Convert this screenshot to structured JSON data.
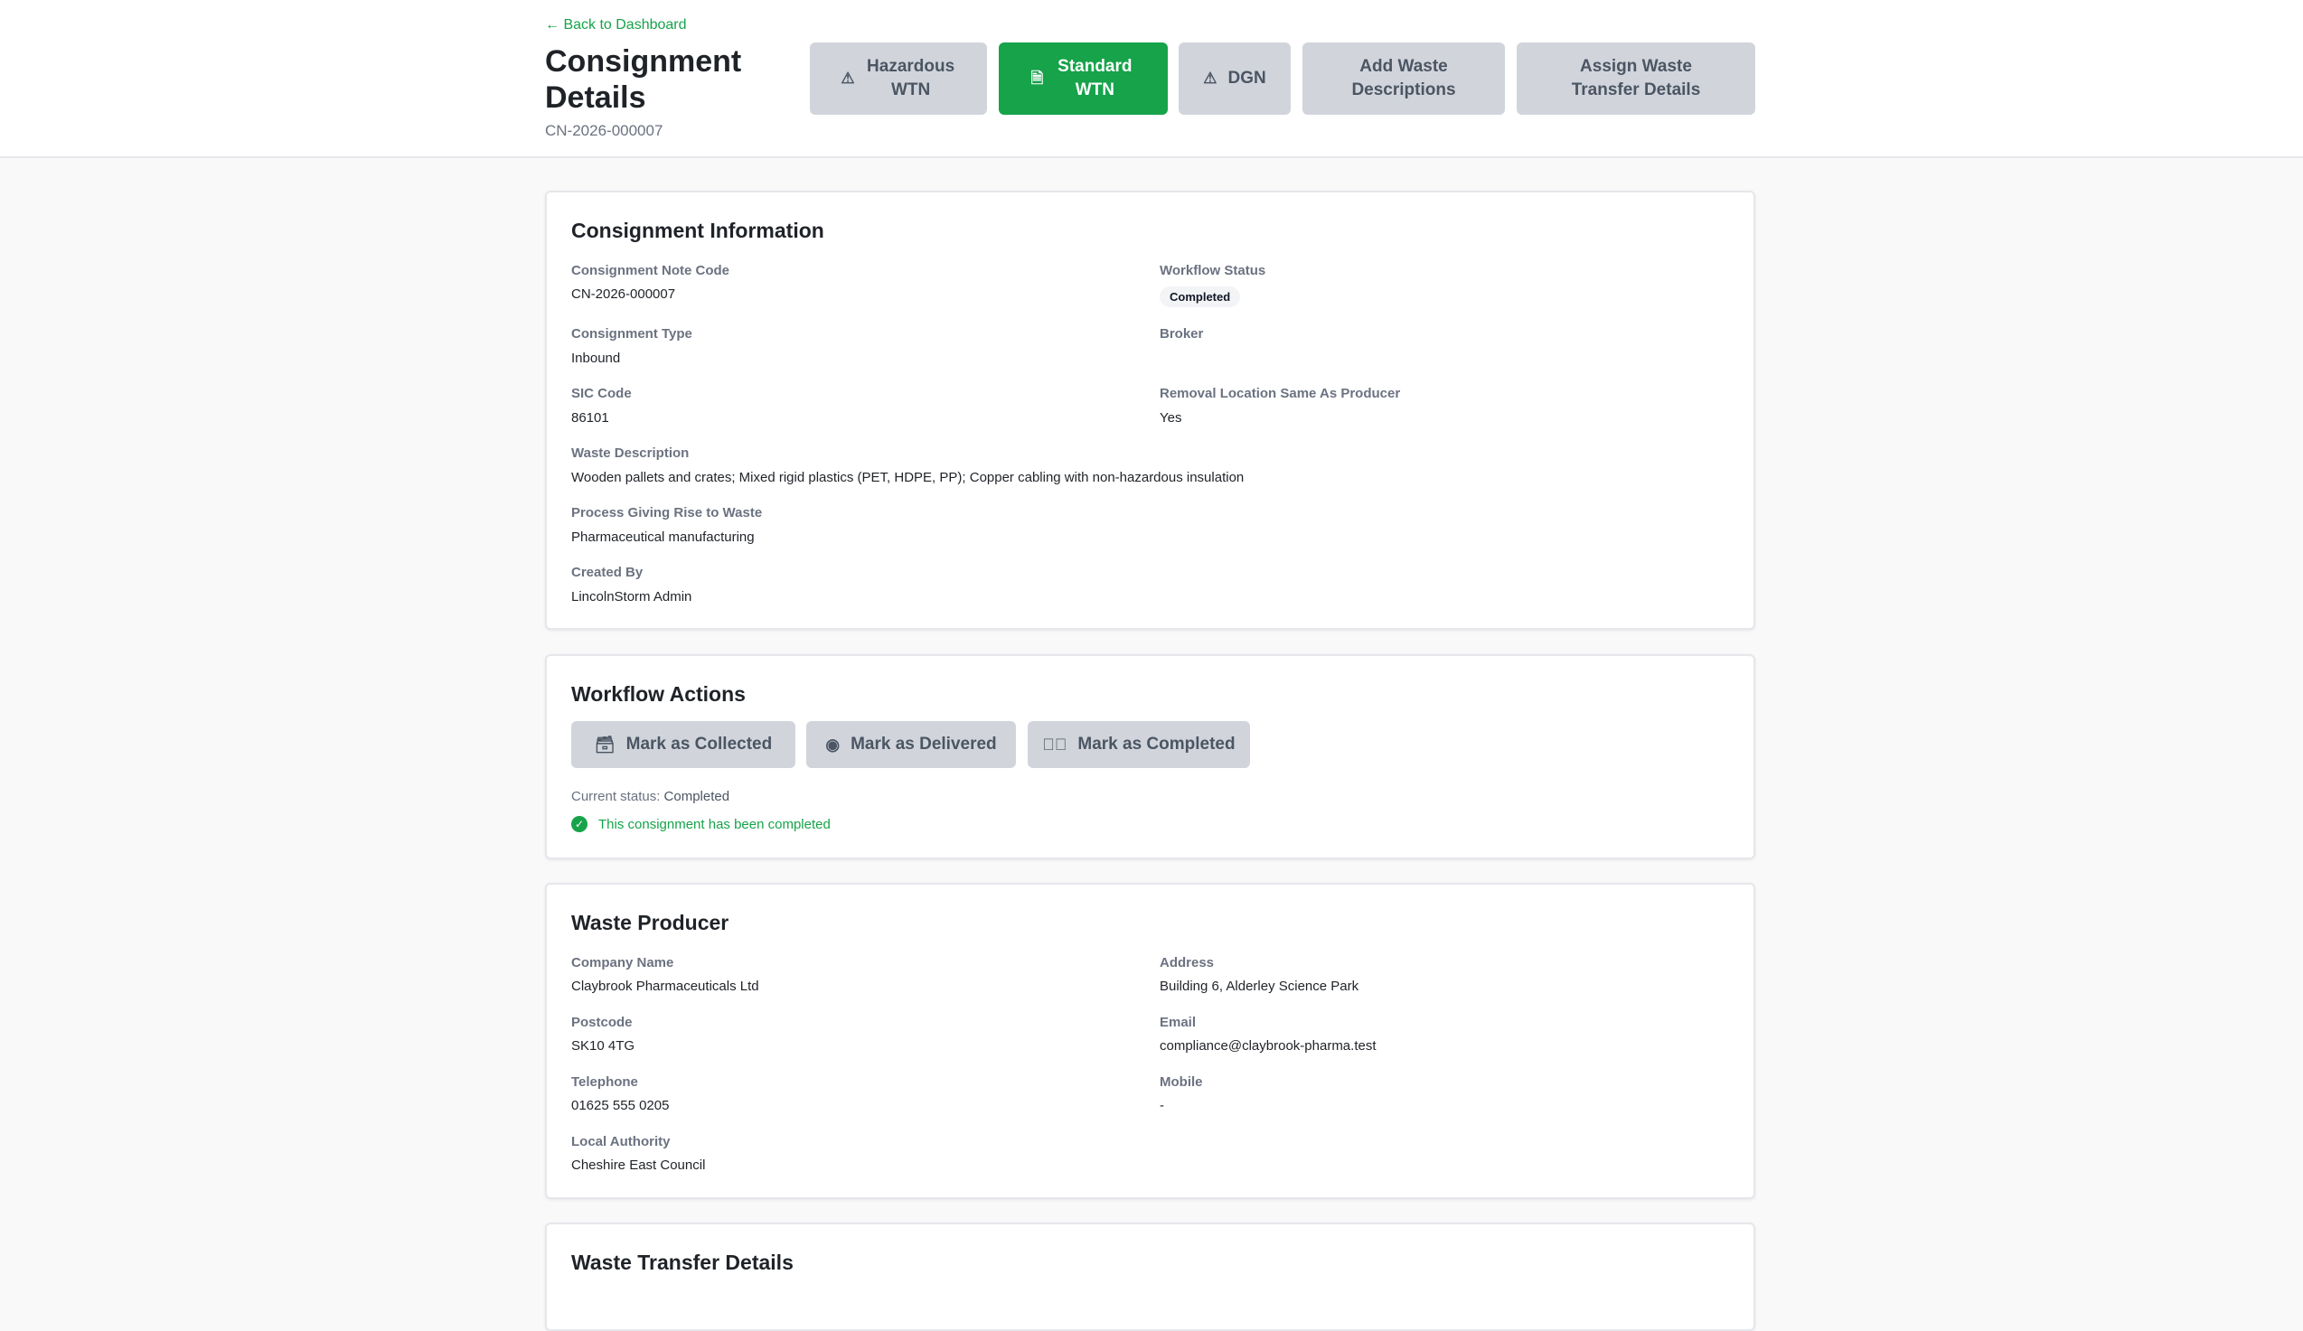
{
  "header": {
    "back_label": "← Back to Dashboard",
    "title": "Consignment Details",
    "code": "CN-2026-000007",
    "buttons": [
      {
        "label": "Hazardous WTN",
        "icon": "warning-triangle-icon"
      },
      {
        "label": "Standard WTN",
        "icon": "document-icon",
        "active": true
      },
      {
        "label": "DGN",
        "icon": "warning-triangle-icon"
      },
      {
        "label": "Add Waste Descriptions"
      },
      {
        "label": "Assign Waste Transfer Details"
      }
    ]
  },
  "consignment_info": {
    "heading": "Consignment Information",
    "note_code_label": "Consignment Note Code",
    "note_code": "CN-2026-000007",
    "workflow_status_label": "Workflow Status",
    "workflow_status": "Completed",
    "type_label": "Consignment Type",
    "type": "Inbound",
    "broker_label": "Broker",
    "sic_label": "SIC Code",
    "sic": "86101",
    "removal_label": "Removal Location Same As Producer",
    "removal": "Yes",
    "waste_desc_label": "Waste Description",
    "waste_desc": "Wooden pallets and crates; Mixed rigid plastics (PET, HDPE, PP); Copper cabling with non-hazardous insulation",
    "process_label": "Process Giving Rise to Waste",
    "process": "Pharmaceutical manufacturing",
    "created_by_label": "Created By",
    "created_by": "LincolnStorm Admin"
  },
  "workflow": {
    "heading": "Workflow Actions",
    "buttons": [
      {
        "label": "Mark as Collected",
        "icon": "archive-box-icon"
      },
      {
        "label": "Mark as Delivered",
        "icon": "map-pin-icon"
      },
      {
        "label": "Mark as Completed",
        "icon": "check-circle-icon"
      }
    ],
    "current_status_label": "Current status:",
    "current_status": "Completed",
    "completed_message": "This consignment has been completed"
  },
  "producer": {
    "heading": "Waste Producer",
    "company_label": "Company Name",
    "company": "Claybrook Pharmaceuticals Ltd",
    "address_label": "Address",
    "address": "Building 6, Alderley Science Park",
    "postcode_label": "Postcode",
    "postcode": "SK10 4TG",
    "email_label": "Email",
    "email": "compliance@claybrook-pharma.test",
    "telephone_label": "Telephone",
    "telephone": "01625 555 0205",
    "mobile_label": "Mobile",
    "mobile": "-",
    "authority_label": "Local Authority",
    "authority": "Cheshire East Council"
  },
  "transfer": {
    "heading": "Waste Transfer Details"
  },
  "colors": {
    "accent": "#16a34a",
    "button_gray": "#d1d5db",
    "background": "#f9f9f9"
  }
}
